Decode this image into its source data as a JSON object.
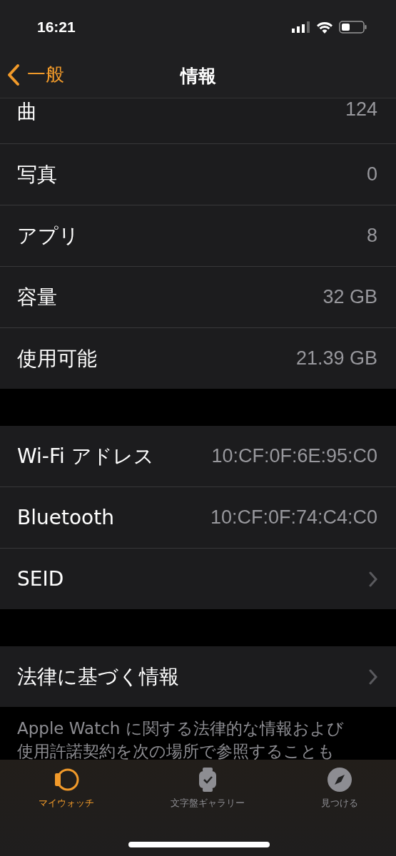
{
  "status_bar": {
    "time": "16:21"
  },
  "nav": {
    "back": "一般",
    "title": "情報"
  },
  "groups": [
    {
      "rows": [
        {
          "label": "曲",
          "value": "124",
          "kind": "value",
          "partial": true
        },
        {
          "label": "写真",
          "value": "0",
          "kind": "value"
        },
        {
          "label": "アプリ",
          "value": "8",
          "kind": "value"
        },
        {
          "label": "容量",
          "value": "32 GB",
          "kind": "value"
        },
        {
          "label": "使用可能",
          "value": "21.39 GB",
          "kind": "value"
        }
      ]
    },
    {
      "rows": [
        {
          "label": "Wi-Fi アドレス",
          "value": "10:CF:0F:6E:95:C0",
          "kind": "value"
        },
        {
          "label": "Bluetooth",
          "value": "10:CF:0F:74:C4:C0",
          "kind": "value"
        },
        {
          "label": "SEID",
          "kind": "link"
        }
      ]
    },
    {
      "rows": [
        {
          "label": "法律に基づく情報",
          "kind": "link"
        }
      ]
    }
  ],
  "footer": [
    "Apple Watch に関する法律的な情報および",
    "使用許諾契約を次の場所で参照することも"
  ],
  "tabs": [
    {
      "label": "マイウォッチ",
      "kind": "mywatch",
      "selected": true
    },
    {
      "label": "文字盤ギャラリー",
      "kind": "face",
      "selected": false
    },
    {
      "label": "見つける",
      "kind": "compass",
      "selected": false
    }
  ]
}
